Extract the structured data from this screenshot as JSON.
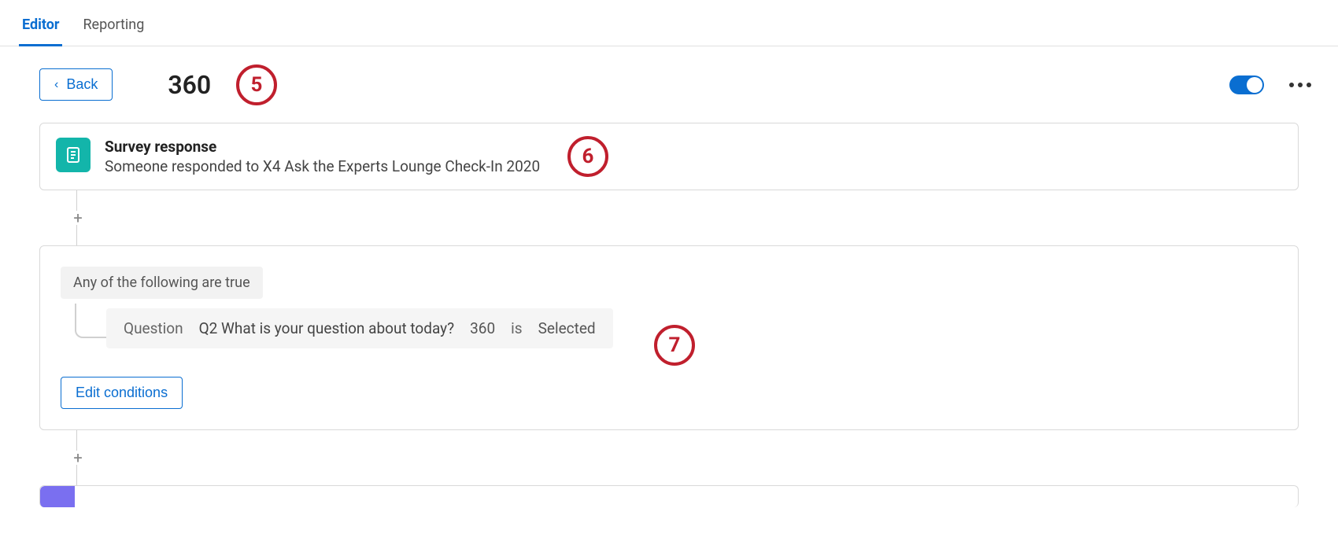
{
  "tabs": {
    "editor": "Editor",
    "reporting": "Reporting"
  },
  "back": {
    "label": "Back"
  },
  "title": "360",
  "trigger": {
    "title": "Survey response",
    "subtitle": "Someone responded to X4 Ask the Experts Lounge Check-In 2020"
  },
  "conditions": {
    "header": "Any of the following are true",
    "row": {
      "field_label": "Question",
      "question": "Q2 What is your question about today?",
      "value": "360",
      "verb": "is",
      "state": "Selected"
    },
    "edit_label": "Edit conditions"
  },
  "annotations": {
    "a5": "5",
    "a6": "6",
    "a7": "7"
  }
}
